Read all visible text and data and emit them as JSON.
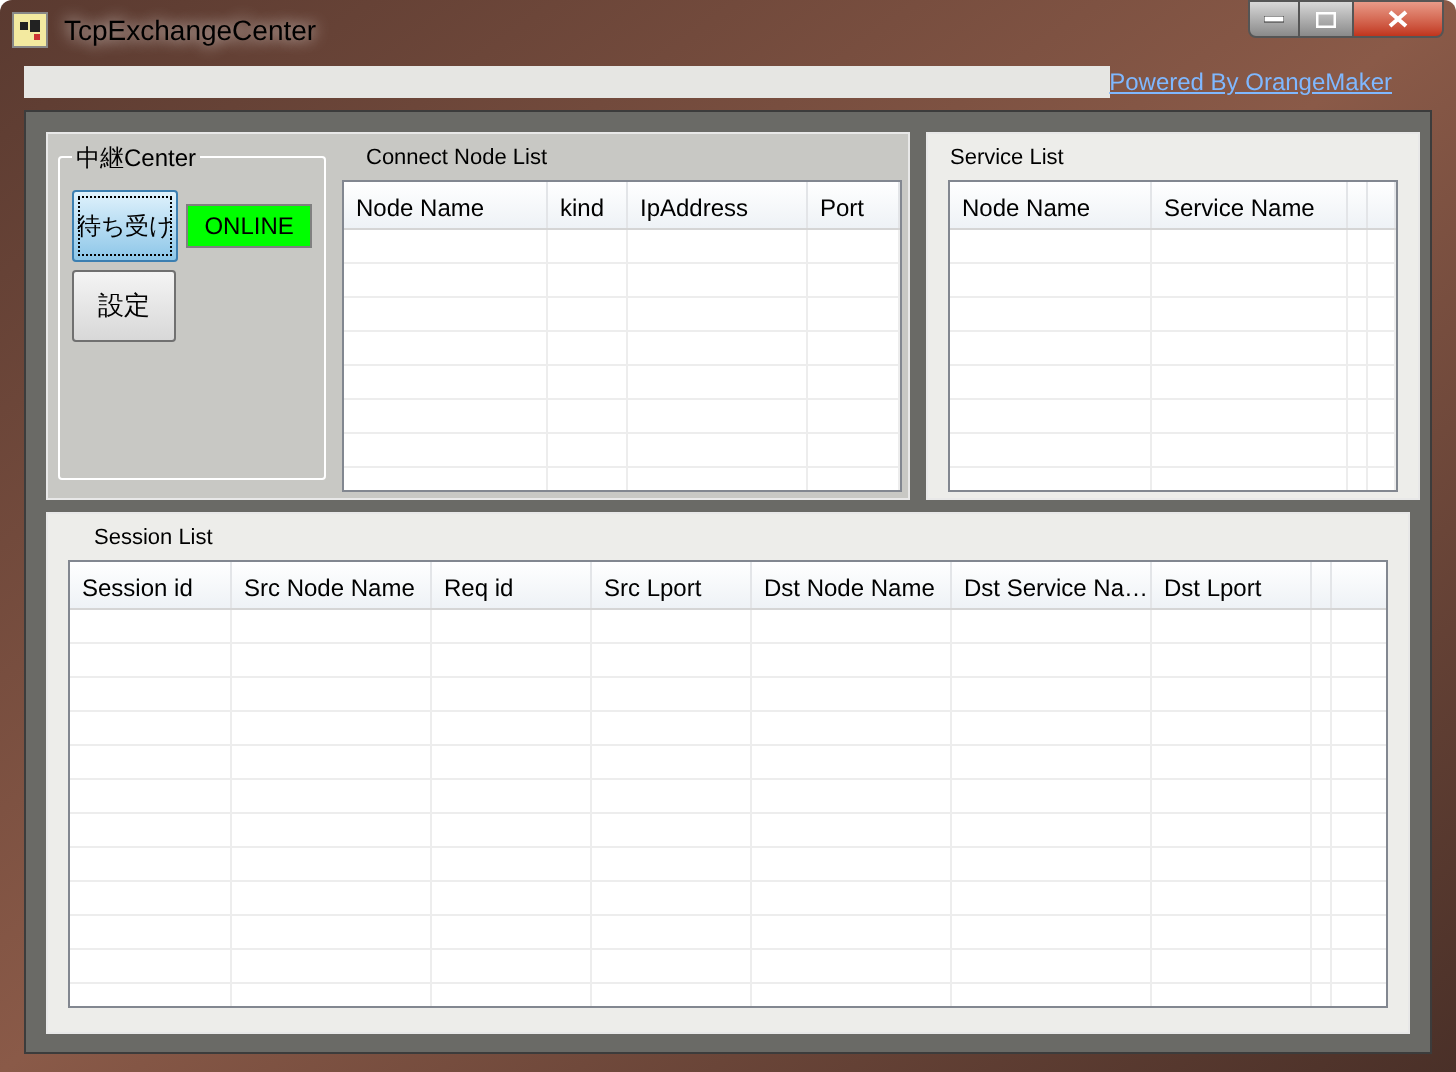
{
  "window": {
    "title": "TcpExchangeCenter"
  },
  "toolbar": {
    "link": "Powered By OrangeMaker"
  },
  "center": {
    "title": "中継Center",
    "buttons": [
      {
        "label": "待ち受け",
        "pressed": true
      },
      {
        "label": "設定",
        "pressed": false
      }
    ],
    "status": "ONLINE"
  },
  "connect_node_list": {
    "title": "Connect Node List",
    "columns": [
      "Node Name",
      "kind",
      "IpAddress",
      "Port"
    ]
  },
  "service_list": {
    "title": "Service List",
    "columns": [
      "Node Name",
      "Service Name"
    ]
  },
  "session_list": {
    "title": "Session List",
    "columns": [
      "Session id",
      "Src Node Name",
      "Req id",
      "Src Lport",
      "Dst Node Name",
      "Dst Service Na…",
      "Dst Lport"
    ]
  }
}
